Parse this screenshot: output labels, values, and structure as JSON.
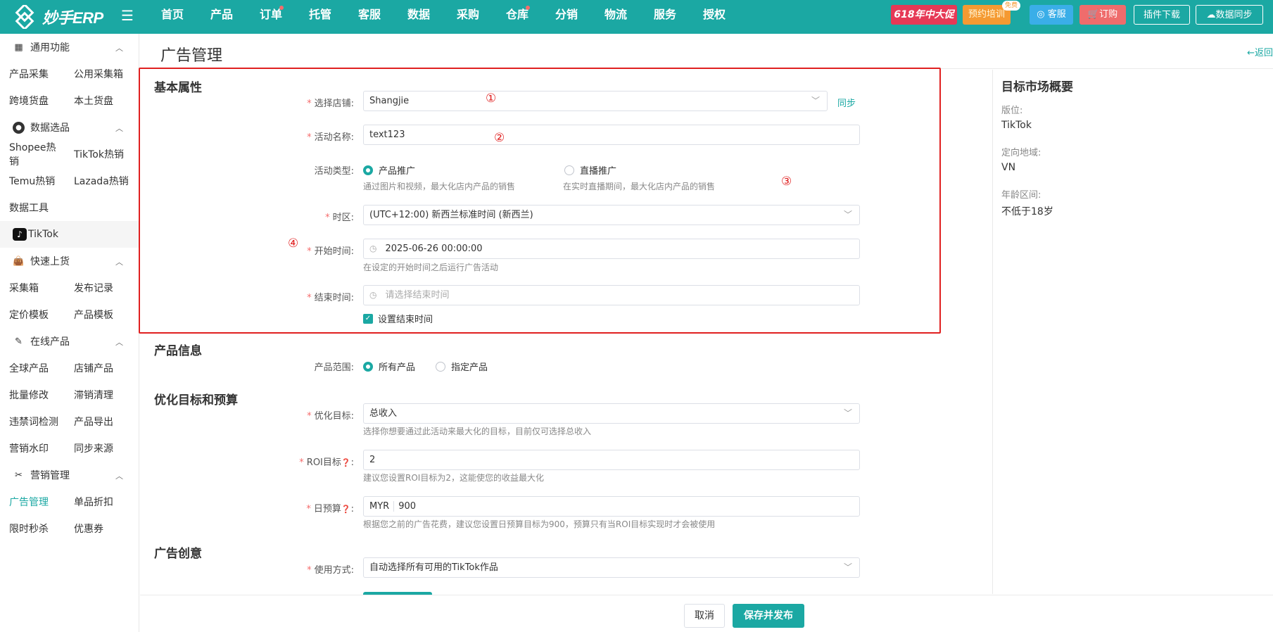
{
  "app": {
    "logo_text": "妙手ERP"
  },
  "nav": [
    {
      "label": "首页",
      "dot": false
    },
    {
      "label": "产品",
      "dot": false
    },
    {
      "label": "订单",
      "dot": true
    },
    {
      "label": "托管",
      "dot": false
    },
    {
      "label": "客服",
      "dot": false
    },
    {
      "label": "数据",
      "dot": false
    },
    {
      "label": "采购",
      "dot": false
    },
    {
      "label": "仓库",
      "dot": true
    },
    {
      "label": "分销",
      "dot": false
    },
    {
      "label": "物流",
      "dot": false
    },
    {
      "label": "服务",
      "dot": false
    },
    {
      "label": "授权",
      "dot": false
    }
  ],
  "topbar": {
    "promo": "618年中大促",
    "training": "预约培训",
    "free_badge": "免费",
    "service": "客服",
    "order": "订购",
    "plugin": "插件下载",
    "data_sync": "数据同步"
  },
  "sidebar": {
    "g1": "通用功能",
    "g1_items": [
      [
        "产品采集",
        "公用采集箱"
      ],
      [
        "跨境货盘",
        "本土货盘"
      ]
    ],
    "g2": "数据选品",
    "g2_items": [
      [
        "Shopee热销",
        "TikTok热销"
      ],
      [
        "Temu热销",
        "Lazada热销"
      ]
    ],
    "g2_tool": "数据工具",
    "tiktok": "TikTok",
    "g3": "快速上货",
    "g3_items": [
      [
        "采集箱",
        "发布记录"
      ],
      [
        "定价模板",
        "产品模板"
      ]
    ],
    "g4": "在线产品",
    "g4_items": [
      [
        "全球产品",
        "店铺产品"
      ],
      [
        "批量修改",
        "滞销清理"
      ],
      [
        "违禁词检测",
        "产品导出"
      ],
      [
        "营销水印",
        "同步来源"
      ]
    ],
    "g5": "营销管理",
    "g5_items": [
      [
        "广告管理",
        "单品折扣"
      ],
      [
        "限时秒杀",
        "优惠券"
      ]
    ]
  },
  "page": {
    "title": "广告管理",
    "back": "←返回"
  },
  "basic": {
    "section": "基本属性",
    "store_label": "选择店铺:",
    "store_value": "Shangjie",
    "sync": "同步",
    "name_label": "活动名称:",
    "name_value": "text123",
    "type_label": "活动类型:",
    "type_opt1": "产品推广",
    "type_opt1_hint": "通过图片和视频，最大化店内产品的销售",
    "type_opt2": "直播推广",
    "type_opt2_hint": "在实时直播期间，最大化店内产品的销售",
    "tz_label": "时区:",
    "tz_value": "(UTC+12:00) 新西兰标准时间 (新西兰)",
    "start_label": "开始时间:",
    "start_value": "2025-06-26 00:00:00",
    "start_hint": "在设定的开始时间之后运行广告活动",
    "end_label": "结束时间:",
    "end_placeholder": "请选择结束时间",
    "set_end": "设置结束时间"
  },
  "product": {
    "section": "产品信息",
    "range_label": "产品范围:",
    "opt1": "所有产品",
    "opt2": "指定产品"
  },
  "optimize": {
    "section": "优化目标和预算",
    "goal_label": "优化目标:",
    "goal_value": "总收入",
    "goal_hint": "选择你想要通过此活动来最大化的目标，目前仅可选择总收入",
    "roi_label": "ROI目标",
    "roi_value": "2",
    "roi_hint": "建议您设置ROI目标为2，这能使您的收益最大化",
    "budget_label": "日预算",
    "budget_currency": "MYR",
    "budget_value": "900",
    "budget_hint": "根据您之前的广告花费，建议您设置日预算目标为900，预算只有当ROI目标实现时才会被使用"
  },
  "creative": {
    "section": "广告创意",
    "use_label": "使用方式:",
    "use_value": "自动选择所有可用的TikTok作品"
  },
  "annotations": {
    "a1": "①",
    "a2": "②",
    "a3": "③",
    "a4": "④"
  },
  "right_panel": {
    "title": "目标市场概要",
    "slot_label": "版位:",
    "slot_value": "TikTok",
    "region_label": "定向地域:",
    "region_value": "VN",
    "age_label": "年龄区间:",
    "age_value": "不低于18岁"
  },
  "footer": {
    "cancel": "取消",
    "save": "保存并发布"
  },
  "colors": {
    "primary": "#1ba8a3",
    "annotation": "#e02020",
    "required": "#f56c6c"
  }
}
